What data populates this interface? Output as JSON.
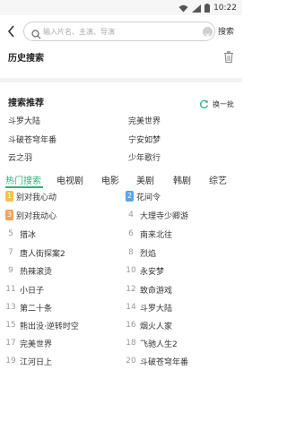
{
  "status_bar": {
    "time": "10:22"
  },
  "search": {
    "placeholder": "输入片名、主演、导演",
    "value": "",
    "submit_label": "搜索"
  },
  "history": {
    "title": "历史搜索"
  },
  "recommend": {
    "title": "搜索推荐",
    "refresh_label": "换一批",
    "items": [
      "斗罗大陆",
      "完美世界",
      "斗破苍穹年番",
      "宁安如梦",
      "云之羽",
      "少年歌行"
    ]
  },
  "hot": {
    "tabs": [
      "热门搜索",
      "电视剧",
      "电影",
      "美剧",
      "韩剧",
      "综艺"
    ],
    "active_tab": "热门搜索",
    "items": [
      {
        "rank": "1",
        "title": "别对我心动"
      },
      {
        "rank": "2",
        "title": "花间令"
      },
      {
        "rank": "3",
        "title": "别对我动心"
      },
      {
        "rank": "4",
        "title": "大理寺少卿游"
      },
      {
        "rank": "5",
        "title": "猎冰"
      },
      {
        "rank": "6",
        "title": "南来北往"
      },
      {
        "rank": "7",
        "title": "唐人街探案2"
      },
      {
        "rank": "8",
        "title": "烈焰"
      },
      {
        "rank": "9",
        "title": "热辣滚烫"
      },
      {
        "rank": "10",
        "title": "永安梦"
      },
      {
        "rank": "11",
        "title": "小日子"
      },
      {
        "rank": "12",
        "title": "致命游戏"
      },
      {
        "rank": "13",
        "title": "第二十条"
      },
      {
        "rank": "14",
        "title": "斗罗大陆"
      },
      {
        "rank": "15",
        "title": "熊出没·逆转时空"
      },
      {
        "rank": "16",
        "title": "烟火人家"
      },
      {
        "rank": "17",
        "title": "完美世界"
      },
      {
        "rank": "18",
        "title": "飞驰人生2"
      },
      {
        "rank": "19",
        "title": "江河日上"
      },
      {
        "rank": "20",
        "title": "斗破苍穹年番"
      }
    ],
    "badge_colors": {
      "1": "#f6c04a",
      "2": "#5aa3e6",
      "3": "#f0a35a"
    }
  },
  "colors": {
    "accent": "#2fb37a"
  }
}
